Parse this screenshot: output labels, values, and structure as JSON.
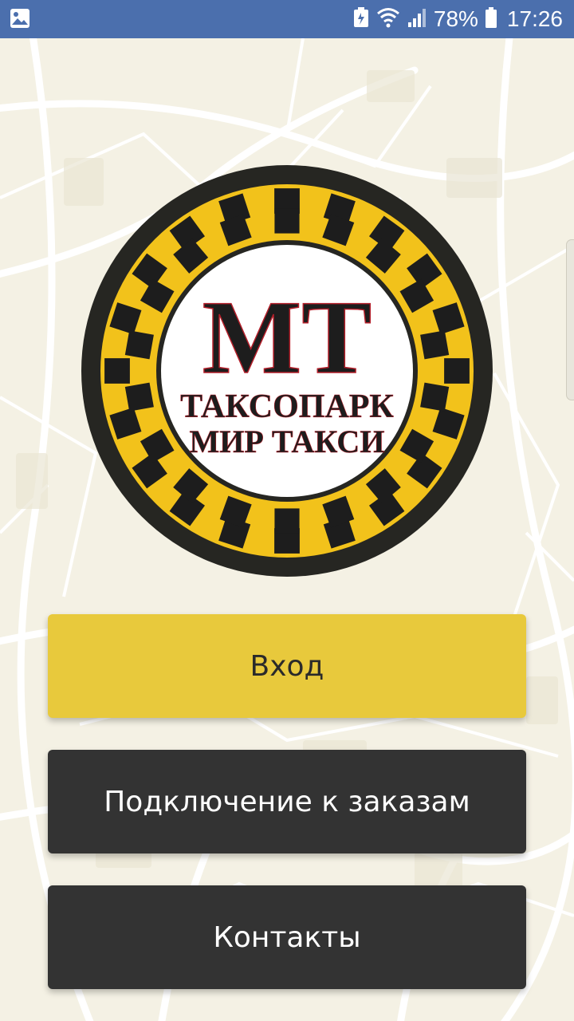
{
  "status_bar": {
    "battery_percent": "78%",
    "time": "17:26",
    "icons": [
      "image-icon",
      "battery-saver-icon",
      "wifi-icon",
      "signal-icon",
      "battery-icon"
    ]
  },
  "logo": {
    "monogram": "МТ",
    "line1": "ТАКСОПАРК",
    "line2": "МИР ТАКСИ",
    "colors": {
      "ring": "#262622",
      "yellow": "#f2c21b",
      "check": "#1d1d1d",
      "center": "#ffffff"
    }
  },
  "buttons": {
    "login": "Вход",
    "connect": "Подключение к заказам",
    "contacts": "Контакты"
  },
  "colors": {
    "status_bar": "#4b6fad",
    "login_button": "#e8c93c",
    "dark_button": "#333333",
    "background": "#f4f1e4"
  }
}
